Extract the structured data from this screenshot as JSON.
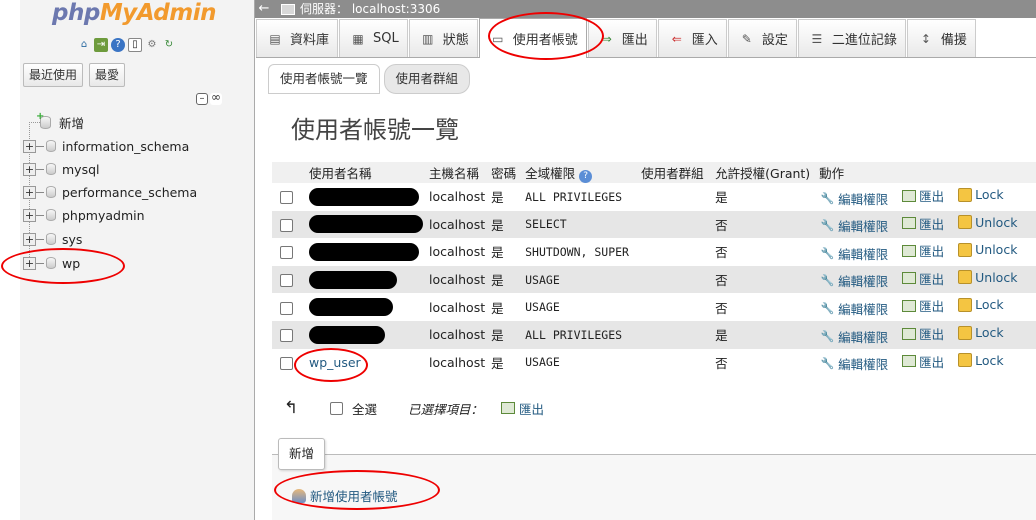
{
  "app": {
    "logo_php": "php",
    "logo_myadmin": "MyAdmin"
  },
  "nav": {
    "recent_btn": "最近使用",
    "favorites_btn": "最愛",
    "tree": {
      "new_label": "新增",
      "databases": [
        "information_schema",
        "mysql",
        "performance_schema",
        "phpmyadmin",
        "sys",
        "wp"
      ]
    }
  },
  "topbar": {
    "server_label": "伺服器： localhost:3306"
  },
  "tabs": [
    {
      "label": "資料庫",
      "icon": "database-icon"
    },
    {
      "label": "SQL",
      "icon": "sql-icon"
    },
    {
      "label": "狀態",
      "icon": "status-icon"
    },
    {
      "label": "使用者帳號",
      "icon": "users-icon",
      "active": true
    },
    {
      "label": "匯出",
      "icon": "export-icon"
    },
    {
      "label": "匯入",
      "icon": "import-icon"
    },
    {
      "label": "設定",
      "icon": "settings-icon"
    },
    {
      "label": "二進位記錄",
      "icon": "binlog-icon"
    },
    {
      "label": "備援",
      "icon": "replication-icon"
    }
  ],
  "subtabs": {
    "overview": "使用者帳號一覽",
    "groups": "使用者群組"
  },
  "page_title": "使用者帳號一覽",
  "table": {
    "headers": {
      "username": "使用者名稱",
      "host": "主機名稱",
      "password": "密碼",
      "global_priv": "全域權限",
      "user_group": "使用者群組",
      "grant": "允許授權(Grant)",
      "action": "動作"
    },
    "rows": [
      {
        "user": "",
        "host": "localhost",
        "password": "是",
        "priv": "ALL PRIVILEGES",
        "grant": "是",
        "lock": "Lock"
      },
      {
        "user": "",
        "host": "localhost",
        "password": "是",
        "priv": "SELECT",
        "grant": "否",
        "lock": "Unlock"
      },
      {
        "user": "",
        "host": "localhost",
        "password": "是",
        "priv": "SHUTDOWN, SUPER",
        "grant": "否",
        "lock": "Unlock"
      },
      {
        "user": "",
        "host": "localhost",
        "password": "是",
        "priv": "USAGE",
        "grant": "否",
        "lock": "Unlock"
      },
      {
        "user": "",
        "host": "localhost",
        "password": "是",
        "priv": "USAGE",
        "grant": "否",
        "lock": "Lock"
      },
      {
        "user": "",
        "host": "localhost",
        "password": "是",
        "priv": "ALL PRIVILEGES",
        "grant": "是",
        "lock": "Lock"
      },
      {
        "user": "wp_user",
        "host": "localhost",
        "password": "是",
        "priv": "USAGE",
        "grant": "否",
        "lock": "Lock"
      }
    ],
    "edit_label": "編輯權限",
    "export_label": "匯出"
  },
  "bulk": {
    "select_all": "全選",
    "with_selected": "已選擇項目：",
    "export": "匯出"
  },
  "add": {
    "legend": "新增",
    "add_user": "新增使用者帳號"
  }
}
